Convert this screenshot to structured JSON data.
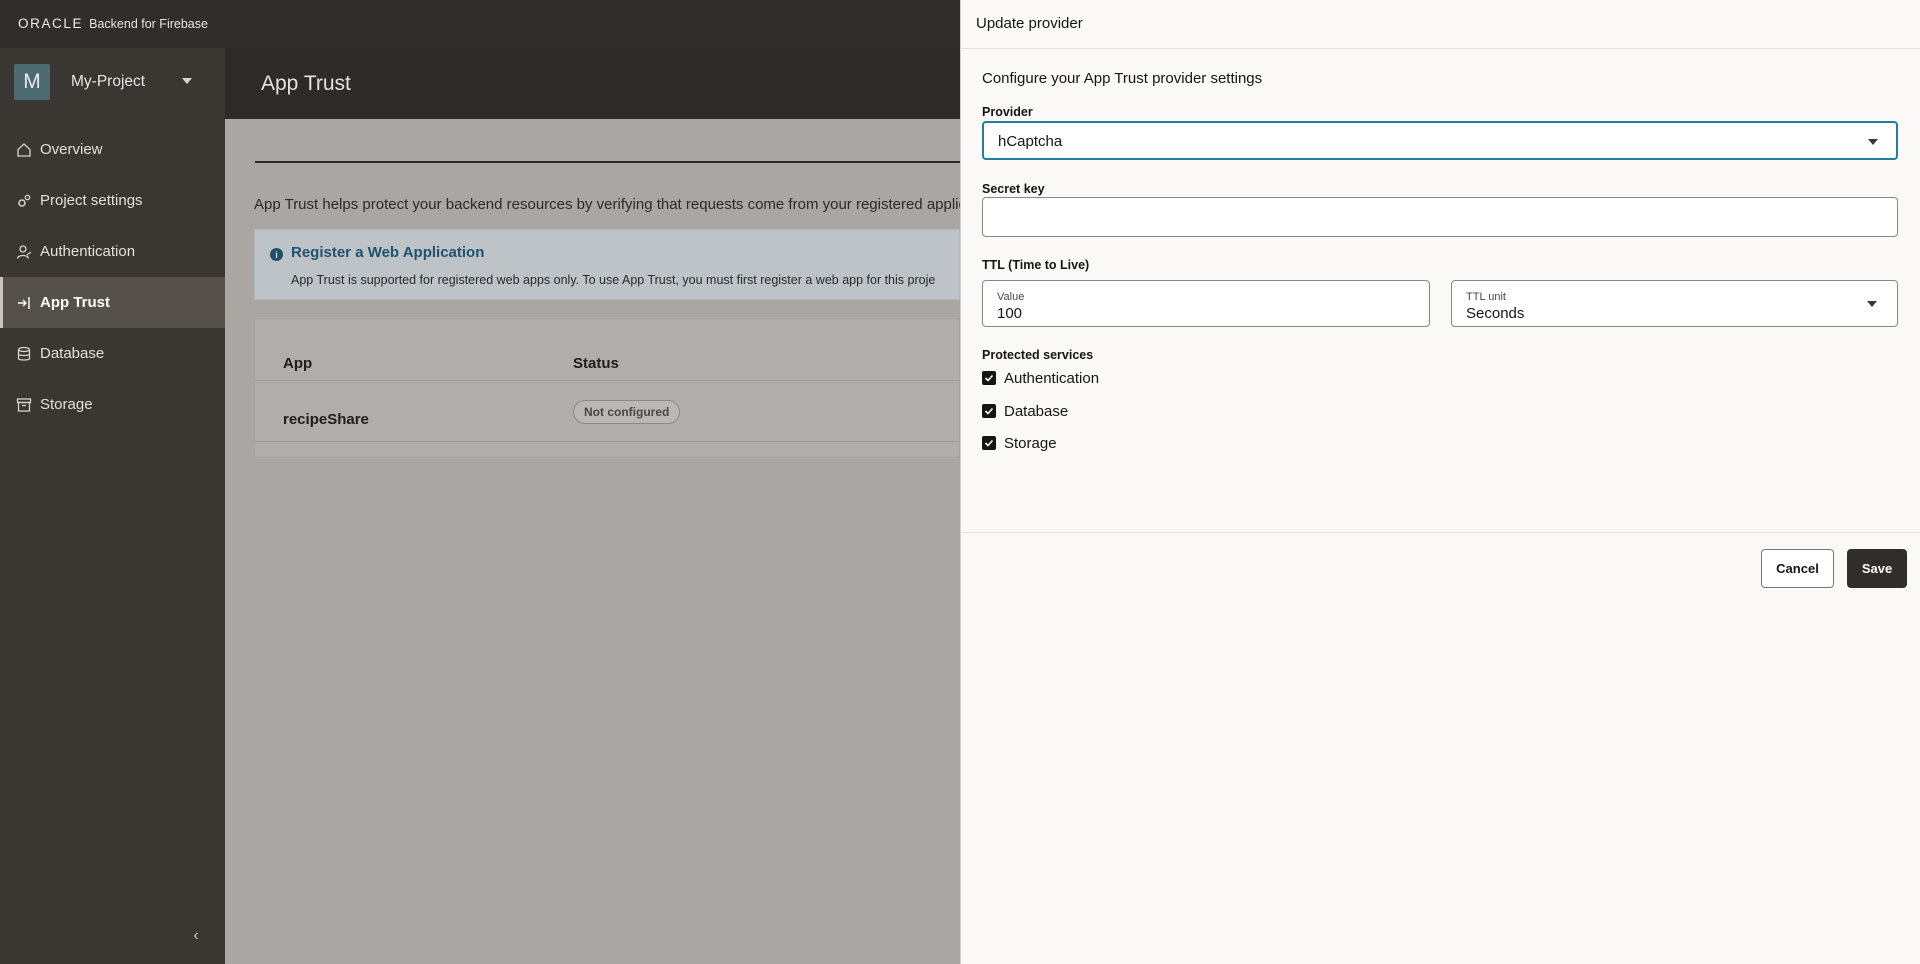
{
  "brand": {
    "logo": "ORACLE",
    "product": "Backend for Firebase"
  },
  "project": {
    "initial": "M",
    "name": "My-Project"
  },
  "nav": {
    "items": [
      {
        "label": "Overview",
        "icon": "home-icon"
      },
      {
        "label": "Project settings",
        "icon": "gears-icon"
      },
      {
        "label": "Authentication",
        "icon": "user-icon"
      },
      {
        "label": "App Trust",
        "icon": "sign-in-icon",
        "active": true
      },
      {
        "label": "Database",
        "icon": "database-icon"
      },
      {
        "label": "Storage",
        "icon": "archive-icon"
      }
    ]
  },
  "main": {
    "title": "App Trust",
    "intro": "App Trust helps protect your backend resources by verifying that requests come from your registered applica",
    "info": {
      "title": "Register a Web Application",
      "text": "App Trust is supported for registered web apps only. To use App Trust, you must first register a web app for this proje"
    },
    "table": {
      "headers": [
        "App",
        "Status"
      ],
      "rows": [
        {
          "app": "recipeShare",
          "status": "Not configured"
        }
      ]
    }
  },
  "drawer": {
    "title": "Update provider",
    "subtitle": "Configure your App Trust provider settings",
    "provider": {
      "label": "Provider",
      "value": "hCaptcha"
    },
    "secret": {
      "label": "Secret key",
      "value": ""
    },
    "ttl": {
      "label": "TTL (Time to Live)",
      "value_label": "Value",
      "value": "100",
      "unit_label": "TTL unit",
      "unit": "Seconds"
    },
    "services": {
      "label": "Protected services",
      "items": [
        {
          "label": "Authentication",
          "checked": true
        },
        {
          "label": "Database",
          "checked": true
        },
        {
          "label": "Storage",
          "checked": true
        }
      ]
    },
    "buttons": {
      "cancel": "Cancel",
      "save": "Save"
    }
  }
}
